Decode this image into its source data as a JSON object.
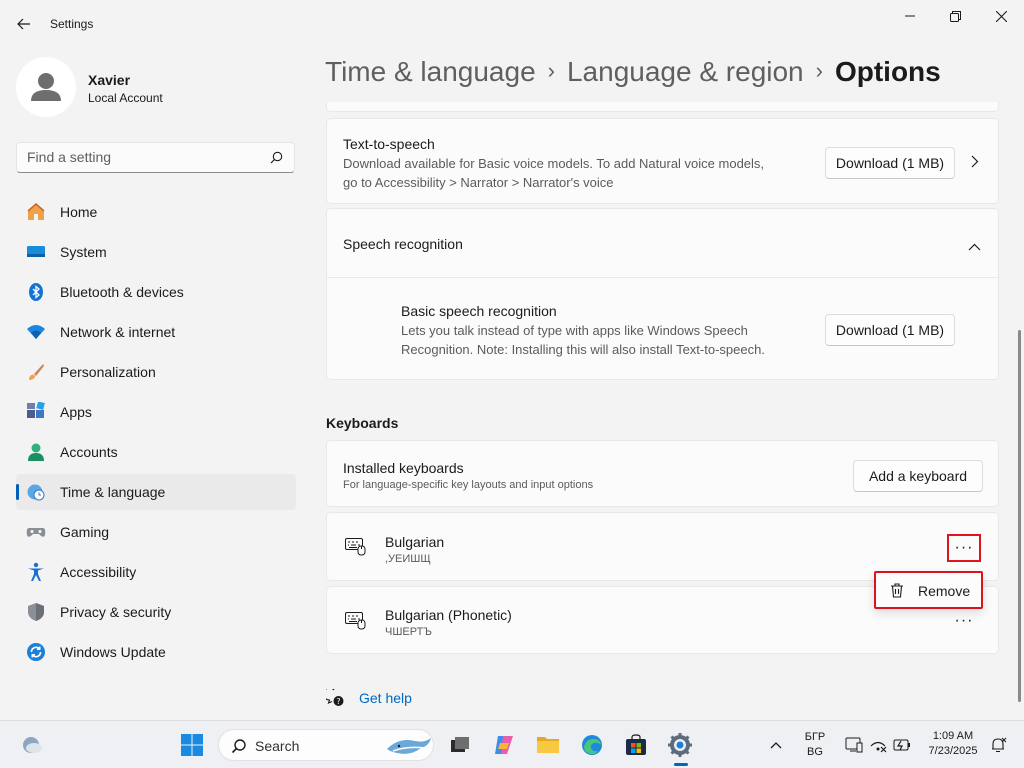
{
  "window": {
    "title": "Settings"
  },
  "profile": {
    "name": "Xavier",
    "account_type": "Local Account"
  },
  "search": {
    "placeholder": "Find a setting"
  },
  "nav": {
    "items": [
      {
        "label": "Home",
        "icon": "home-icon"
      },
      {
        "label": "System",
        "icon": "system-icon"
      },
      {
        "label": "Bluetooth & devices",
        "icon": "bluetooth-icon"
      },
      {
        "label": "Network & internet",
        "icon": "wifi-icon"
      },
      {
        "label": "Personalization",
        "icon": "brush-icon"
      },
      {
        "label": "Apps",
        "icon": "apps-icon"
      },
      {
        "label": "Accounts",
        "icon": "accounts-icon"
      },
      {
        "label": "Time & language",
        "icon": "time-language-icon",
        "active": true
      },
      {
        "label": "Gaming",
        "icon": "gamepad-icon"
      },
      {
        "label": "Accessibility",
        "icon": "accessibility-icon"
      },
      {
        "label": "Privacy & security",
        "icon": "shield-icon"
      },
      {
        "label": "Windows Update",
        "icon": "update-icon"
      }
    ]
  },
  "breadcrumb": {
    "level1": "Time & language",
    "level2": "Language & region",
    "current": "Options",
    "separator": "›"
  },
  "tts": {
    "title": "Text-to-speech",
    "desc_line1": "Download available for Basic voice models. To add Natural voice models,",
    "desc_line2": "go to Accessibility > Narrator > Narrator's voice",
    "button": "Download (1 MB)"
  },
  "speech": {
    "title": "Speech recognition",
    "basic_title": "Basic speech recognition",
    "basic_desc_line1": "Lets you talk instead of type with apps like Windows Speech",
    "basic_desc_line2": "Recognition. Note: Installing this will also install Text-to-speech.",
    "button": "Download (1 MB)"
  },
  "keyboards": {
    "section_title": "Keyboards",
    "installed_title": "Installed keyboards",
    "installed_desc": "For language-specific key layouts and input options",
    "add_button": "Add a keyboard",
    "items": [
      {
        "name": "Bulgarian",
        "sample": ",УЕИШЩ"
      },
      {
        "name": "Bulgarian (Phonetic)",
        "sample": "ЧШЕРТЪ"
      }
    ],
    "more_label": "···"
  },
  "flyout": {
    "remove_label": "Remove"
  },
  "help": {
    "label": "Get help"
  },
  "taskbar": {
    "search_label": "Search",
    "lang_line1": "БГР",
    "lang_line2": "BG",
    "time": "1:09 AM",
    "date": "7/23/2025"
  },
  "colors": {
    "accent": "#005fb8",
    "highlight": "#e0141e",
    "link": "#0067c0"
  }
}
